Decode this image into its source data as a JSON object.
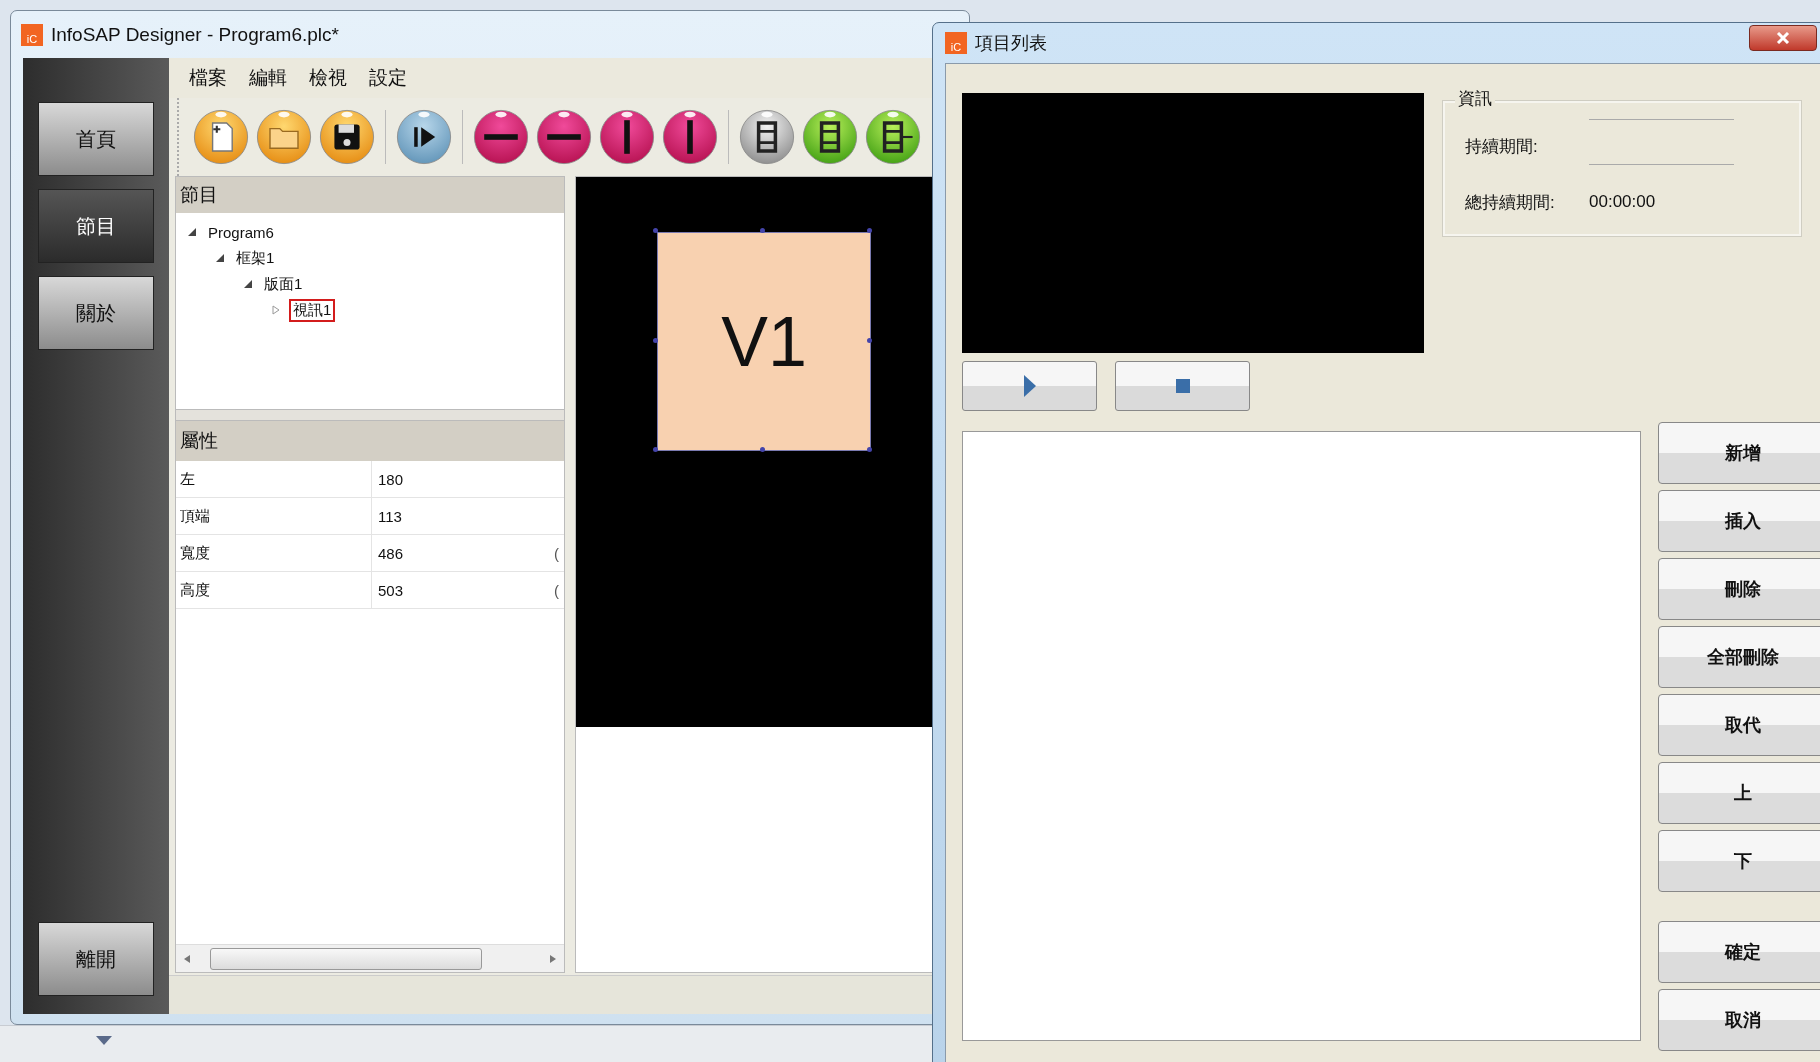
{
  "main_window": {
    "icon_label": "iC",
    "title": "InfoSAP Designer - Program6.plc*",
    "nav": [
      {
        "label": "首頁",
        "selected": false
      },
      {
        "label": "節目",
        "selected": true
      },
      {
        "label": "關於",
        "selected": false
      }
    ],
    "exit_button": "離開",
    "menu": [
      "檔案",
      "編輯",
      "檢視",
      "設定"
    ],
    "program_panel": {
      "title": "節目",
      "tree": [
        {
          "label": "Program6",
          "expanded": true,
          "selected": false,
          "children": [
            {
              "label": "框架1",
              "expanded": true,
              "selected": false,
              "children": [
                {
                  "label": "版面1",
                  "expanded": true,
                  "selected": false,
                  "children": [
                    {
                      "label": "視訊1",
                      "expanded": false,
                      "selected": true
                    }
                  ]
                }
              ]
            }
          ]
        }
      ]
    },
    "properties_panel": {
      "title": "屬性",
      "rows": [
        {
          "name": "左",
          "value": "180"
        },
        {
          "name": "頂端",
          "value": "113"
        },
        {
          "name": "寬度",
          "value": "486",
          "column_3": "("
        },
        {
          "name": "高度",
          "value": "503",
          "column_3": "("
        }
      ]
    },
    "canvas": {
      "elements": [
        {
          "label": "V1",
          "selected": true
        }
      ]
    }
  },
  "dialog": {
    "icon_label": "iC",
    "title": "項目列表",
    "info": {
      "title": "資訊",
      "fields": [
        {
          "label": "持續期間:"
        },
        {
          "label": "總持續期間:",
          "value": "00:00:00"
        }
      ]
    },
    "buttons": [
      "新增",
      "插入",
      "刪除",
      "全部刪除",
      "取代",
      "上",
      "下"
    ],
    "confirm_buttons": [
      "確定",
      "取消"
    ]
  }
}
